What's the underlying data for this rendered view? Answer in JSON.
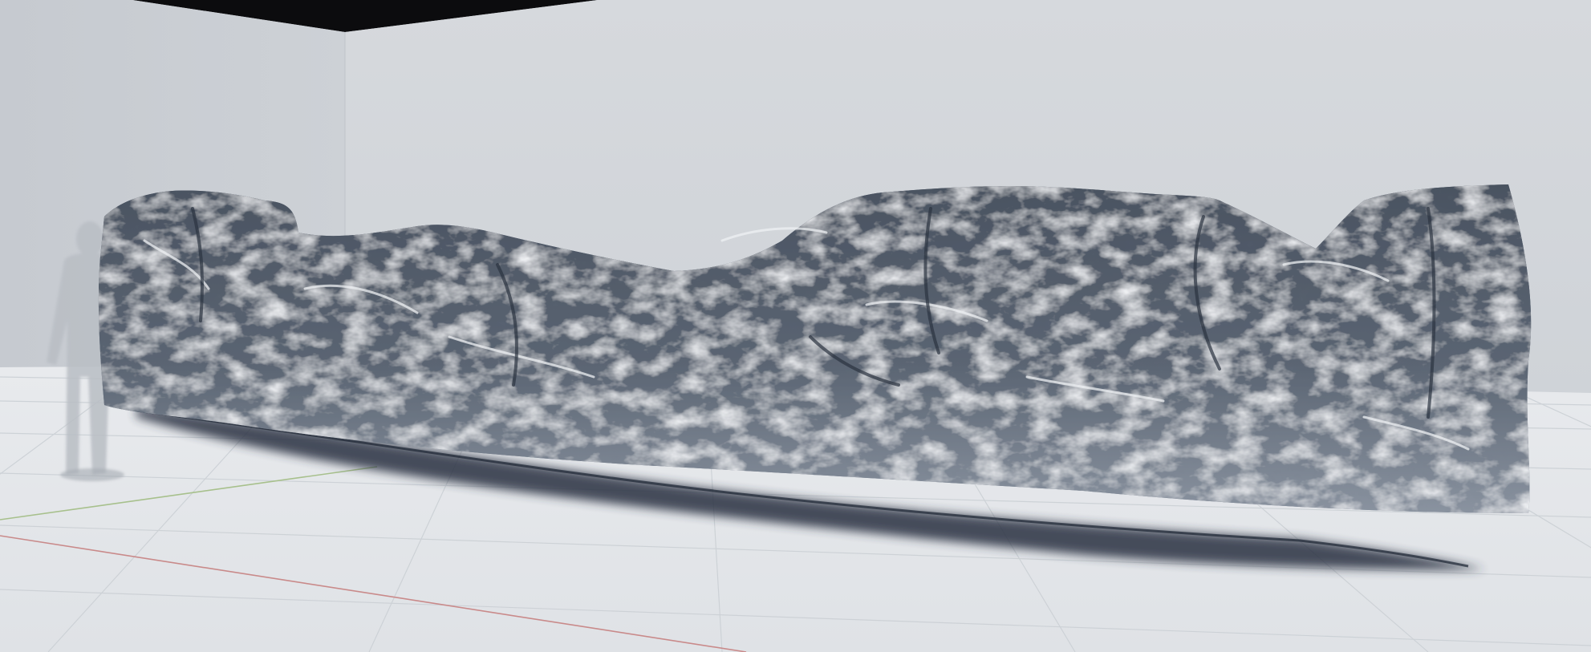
{
  "scene": {
    "subject": "rock-wall-scan",
    "colors": {
      "back_wall": "#d4d7db",
      "left_wall": "#c8ccd1",
      "ceiling": "#0c0c0e",
      "floor": "#e4e7ea",
      "grid_line": "#c9cdd2",
      "axis_x": "#c98a8a",
      "axis_y": "#a7c08c",
      "rock_dark": "#3b4350",
      "rock_mid": "#6a7482",
      "rock_light": "#e9ecef",
      "shadow": "#2a3342",
      "figure": "#b9bec4"
    }
  }
}
